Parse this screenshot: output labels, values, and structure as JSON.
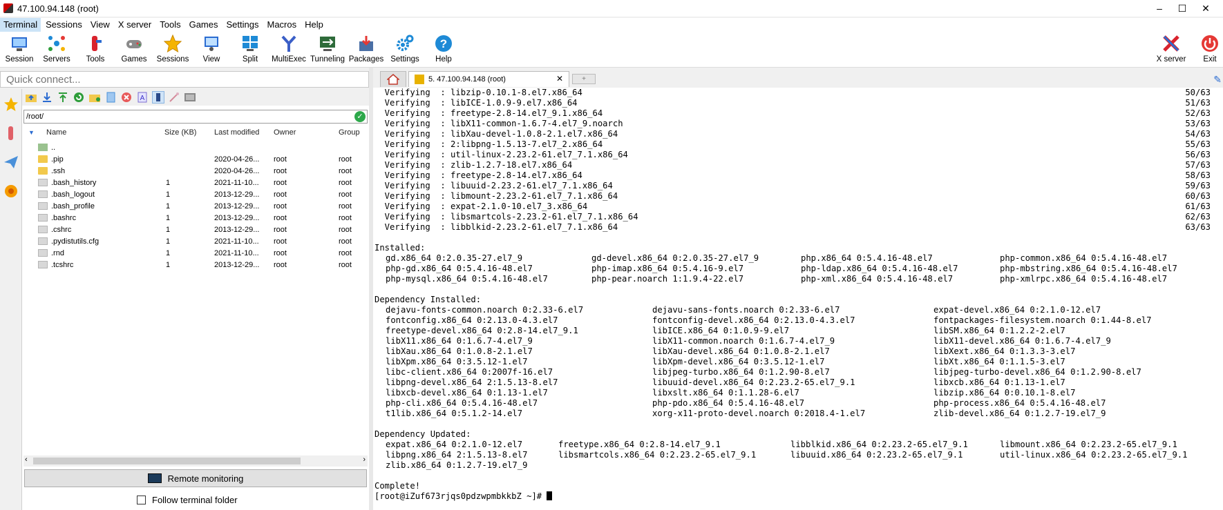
{
  "window": {
    "title": "47.100.94.148 (root)",
    "controls": [
      "–",
      "☐",
      "✕"
    ]
  },
  "menu": [
    "Terminal",
    "Sessions",
    "View",
    "X server",
    "Tools",
    "Games",
    "Settings",
    "Macros",
    "Help"
  ],
  "toolbar": {
    "tools": [
      {
        "label": "Session",
        "icon": "session-icon",
        "color": "#2a6bd1"
      },
      {
        "label": "Servers",
        "icon": "servers-icon",
        "color": "#1e8ad6"
      },
      {
        "label": "Tools",
        "icon": "tools-icon",
        "color": "#d9232d"
      },
      {
        "label": "Games",
        "icon": "games-icon",
        "color": "#777777"
      },
      {
        "label": "Sessions",
        "icon": "star-icon",
        "color": "#f5b400"
      },
      {
        "label": "View",
        "icon": "view-icon",
        "color": "#2a6bd1"
      },
      {
        "label": "Split",
        "icon": "split-icon",
        "color": "#1e8ad6"
      },
      {
        "label": "MultiExec",
        "icon": "multiexec-icon",
        "color": "#3b5fc7"
      },
      {
        "label": "Tunneling",
        "icon": "tunneling-icon",
        "color": "#2e9d3a"
      },
      {
        "label": "Packages",
        "icon": "packages-icon",
        "color": "#4a6fa5"
      },
      {
        "label": "Settings",
        "icon": "gear-icon",
        "color": "#1e8ad6"
      },
      {
        "label": "Help",
        "icon": "help-icon",
        "color": "#1e8ad6"
      }
    ],
    "right_tools": [
      {
        "label": "X server",
        "icon": "x-server-icon",
        "color": "#d9232d"
      },
      {
        "label": "Exit",
        "icon": "power-icon",
        "color": "#e53935"
      }
    ]
  },
  "quick_connect": {
    "placeholder": "Quick connect..."
  },
  "sftp": {
    "path": "/root/",
    "columns": {
      "name": "Name",
      "size": "Size (KB)",
      "modified": "Last modified",
      "owner": "Owner",
      "group": "Group"
    },
    "files": [
      {
        "name": "..",
        "size": "",
        "modified": "",
        "owner": "",
        "group": "",
        "type": "up"
      },
      {
        "name": ".pip",
        "size": "",
        "modified": "2020-04-26...",
        "owner": "root",
        "group": "root",
        "type": "folder"
      },
      {
        "name": ".ssh",
        "size": "",
        "modified": "2020-04-26...",
        "owner": "root",
        "group": "root",
        "type": "folder"
      },
      {
        "name": ".bash_history",
        "size": "1",
        "modified": "2021-11-10...",
        "owner": "root",
        "group": "root",
        "type": "file"
      },
      {
        "name": ".bash_logout",
        "size": "1",
        "modified": "2013-12-29...",
        "owner": "root",
        "group": "root",
        "type": "file"
      },
      {
        "name": ".bash_profile",
        "size": "1",
        "modified": "2013-12-29...",
        "owner": "root",
        "group": "root",
        "type": "file"
      },
      {
        "name": ".bashrc",
        "size": "1",
        "modified": "2013-12-29...",
        "owner": "root",
        "group": "root",
        "type": "file"
      },
      {
        "name": ".cshrc",
        "size": "1",
        "modified": "2013-12-29...",
        "owner": "root",
        "group": "root",
        "type": "file"
      },
      {
        "name": ".pydistutils.cfg",
        "size": "1",
        "modified": "2021-11-10...",
        "owner": "root",
        "group": "root",
        "type": "file"
      },
      {
        "name": ".rnd",
        "size": "1",
        "modified": "2021-11-10...",
        "owner": "root",
        "group": "root",
        "type": "file"
      },
      {
        "name": ".tcshrc",
        "size": "1",
        "modified": "2013-12-29...",
        "owner": "root",
        "group": "root",
        "type": "file"
      }
    ],
    "remote_monitoring": "Remote monitoring",
    "follow_terminal": "Follow terminal folder"
  },
  "tabs": {
    "session_label": "5. 47.100.94.148 (root)",
    "close_glyph": "✕",
    "new_tab_glyph": "+"
  },
  "terminal": {
    "verifying": [
      {
        "text": "  Verifying  : libzip-0.10.1-8.el7.x86_64",
        "count": "50/63"
      },
      {
        "text": "  Verifying  : libICE-1.0.9-9.el7.x86_64",
        "count": "51/63"
      },
      {
        "text": "  Verifying  : freetype-2.8-14.el7_9.1.x86_64",
        "count": "52/63"
      },
      {
        "text": "  Verifying  : libX11-common-1.6.7-4.el7_9.noarch",
        "count": "53/63"
      },
      {
        "text": "  Verifying  : libXau-devel-1.0.8-2.1.el7.x86_64",
        "count": "54/63"
      },
      {
        "text": "  Verifying  : 2:libpng-1.5.13-7.el7_2.x86_64",
        "count": "55/63"
      },
      {
        "text": "  Verifying  : util-linux-2.23.2-61.el7_7.1.x86_64",
        "count": "56/63"
      },
      {
        "text": "  Verifying  : zlib-1.2.7-18.el7.x86_64",
        "count": "57/63"
      },
      {
        "text": "  Verifying  : freetype-2.8-14.el7.x86_64",
        "count": "58/63"
      },
      {
        "text": "  Verifying  : libuuid-2.23.2-61.el7_7.1.x86_64",
        "count": "59/63"
      },
      {
        "text": "  Verifying  : libmount-2.23.2-61.el7_7.1.x86_64",
        "count": "60/63"
      },
      {
        "text": "  Verifying  : expat-2.1.0-10.el7_3.x86_64",
        "count": "61/63"
      },
      {
        "text": "  Verifying  : libsmartcols-2.23.2-61.el7_7.1.x86_64",
        "count": "62/63"
      },
      {
        "text": "  Verifying  : libblkid-2.23.2-61.el7_7.1.x86_64",
        "count": "63/63"
      }
    ],
    "installed_header": "Installed:",
    "installed": [
      [
        "gd.x86_64 0:2.0.35-27.el7_9",
        "gd-devel.x86_64 0:2.0.35-27.el7_9",
        "php.x86_64 0:5.4.16-48.el7",
        "php-common.x86_64 0:5.4.16-48.el7"
      ],
      [
        "php-gd.x86_64 0:5.4.16-48.el7",
        "php-imap.x86_64 0:5.4.16-9.el7",
        "php-ldap.x86_64 0:5.4.16-48.el7",
        "php-mbstring.x86_64 0:5.4.16-48.el7"
      ],
      [
        "php-mysql.x86_64 0:5.4.16-48.el7",
        "php-pear.noarch 1:1.9.4-22.el7",
        "php-xml.x86_64 0:5.4.16-48.el7",
        "php-xmlrpc.x86_64 0:5.4.16-48.el7"
      ]
    ],
    "dep_installed_header": "Dependency Installed:",
    "dep_installed": [
      [
        "dejavu-fonts-common.noarch 0:2.33-6.el7",
        "dejavu-sans-fonts.noarch 0:2.33-6.el7",
        "expat-devel.x86_64 0:2.1.0-12.el7"
      ],
      [
        "fontconfig.x86_64 0:2.13.0-4.3.el7",
        "fontconfig-devel.x86_64 0:2.13.0-4.3.el7",
        "fontpackages-filesystem.noarch 0:1.44-8.el7"
      ],
      [
        "freetype-devel.x86_64 0:2.8-14.el7_9.1",
        "libICE.x86_64 0:1.0.9-9.el7",
        "libSM.x86_64 0:1.2.2-2.el7"
      ],
      [
        "libX11.x86_64 0:1.6.7-4.el7_9",
        "libX11-common.noarch 0:1.6.7-4.el7_9",
        "libX11-devel.x86_64 0:1.6.7-4.el7_9"
      ],
      [
        "libXau.x86_64 0:1.0.8-2.1.el7",
        "libXau-devel.x86_64 0:1.0.8-2.1.el7",
        "libXext.x86_64 0:1.3.3-3.el7"
      ],
      [
        "libXpm.x86_64 0:3.5.12-1.el7",
        "libXpm-devel.x86_64 0:3.5.12-1.el7",
        "libXt.x86_64 0:1.1.5-3.el7"
      ],
      [
        "libc-client.x86_64 0:2007f-16.el7",
        "libjpeg-turbo.x86_64 0:1.2.90-8.el7",
        "libjpeg-turbo-devel.x86_64 0:1.2.90-8.el7"
      ],
      [
        "libpng-devel.x86_64 2:1.5.13-8.el7",
        "libuuid-devel.x86_64 0:2.23.2-65.el7_9.1",
        "libxcb.x86_64 0:1.13-1.el7"
      ],
      [
        "libxcb-devel.x86_64 0:1.13-1.el7",
        "libxslt.x86_64 0:1.1.28-6.el7",
        "libzip.x86_64 0:0.10.1-8.el7"
      ],
      [
        "php-cli.x86_64 0:5.4.16-48.el7",
        "php-pdo.x86_64 0:5.4.16-48.el7",
        "php-process.x86_64 0:5.4.16-48.el7"
      ],
      [
        "t1lib.x86_64 0:5.1.2-14.el7",
        "xorg-x11-proto-devel.noarch 0:2018.4-1.el7",
        "zlib-devel.x86_64 0:1.2.7-19.el7_9"
      ]
    ],
    "dep_updated_header": "Dependency Updated:",
    "dep_updated": [
      [
        "expat.x86_64 0:2.1.0-12.el7",
        "freetype.x86_64 0:2.8-14.el7_9.1",
        "libblkid.x86_64 0:2.23.2-65.el7_9.1",
        "libmount.x86_64 0:2.23.2-65.el7_9.1"
      ],
      [
        "libpng.x86_64 2:1.5.13-8.el7",
        "libsmartcols.x86_64 0:2.23.2-65.el7_9.1",
        "libuuid.x86_64 0:2.23.2-65.el7_9.1",
        "util-linux.x86_64 0:2.23.2-65.el7_9.1"
      ],
      [
        "zlib.x86_64 0:1.2.7-19.el7_9"
      ]
    ],
    "complete": "Complete!",
    "prompt": "[root@iZuf673rjqs0pdzwpmbkkbZ ~]# "
  }
}
